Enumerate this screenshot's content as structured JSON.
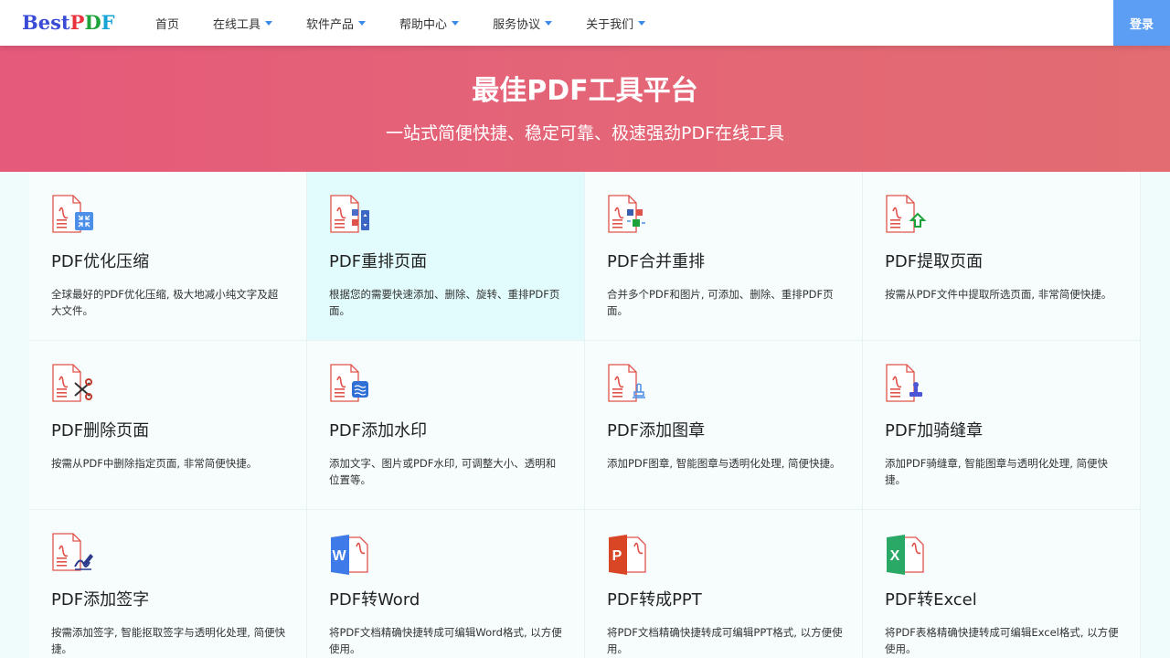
{
  "logo": {
    "best": "Best",
    "p": "P",
    "d": "D",
    "f": "F"
  },
  "nav": [
    {
      "label": "首页",
      "dropdown": false
    },
    {
      "label": "在线工具",
      "dropdown": true
    },
    {
      "label": "软件产品",
      "dropdown": true
    },
    {
      "label": "帮助中心",
      "dropdown": true
    },
    {
      "label": "服务协议",
      "dropdown": true
    },
    {
      "label": "关于我们",
      "dropdown": true
    }
  ],
  "login_label": "登录",
  "hero": {
    "title": "最佳PDF工具平台",
    "subtitle": "一站式简便快捷、稳定可靠、极速强劲PDF在线工具"
  },
  "tools": [
    {
      "name": "PDF优化压缩",
      "desc": "全球最好的PDF优化压缩, 极大地减小纯文字及超大文件。",
      "icon": "compress-icon"
    },
    {
      "name": "PDF重排页面",
      "desc": "根据您的需要快速添加、删除、旋转、重排PDF页面。",
      "icon": "reorder-icon"
    },
    {
      "name": "PDF合并重排",
      "desc": "合并多个PDF和图片, 可添加、删除、重排PDF页面。",
      "icon": "merge-icon"
    },
    {
      "name": "PDF提取页面",
      "desc": "按需从PDF文件中提取所选页面, 非常简便快捷。",
      "icon": "extract-icon"
    },
    {
      "name": "PDF删除页面",
      "desc": "按需从PDF中删除指定页面, 非常简便快捷。",
      "icon": "scissors-icon"
    },
    {
      "name": "PDF添加水印",
      "desc": "添加文字、图片或PDF水印, 可调整大小、透明和位置等。",
      "icon": "watermark-icon"
    },
    {
      "name": "PDF添加图章",
      "desc": "添加PDF图章, 智能图章与透明化处理, 简便快捷。",
      "icon": "stamp-icon"
    },
    {
      "name": "PDF加骑缝章",
      "desc": "添加PDF骑缝章, 智能图章与透明化处理, 简便快捷。",
      "icon": "seal-icon"
    },
    {
      "name": "PDF添加签字",
      "desc": "按需添加签字, 智能抠取签字与透明化处理, 简便快捷。",
      "icon": "signature-icon"
    },
    {
      "name": "PDF转Word",
      "desc": "将PDF文档精确快捷转成可编辑Word格式, 以方便使用。",
      "icon": "word-icon"
    },
    {
      "name": "PDF转成PPT",
      "desc": "将PDF文档精确快捷转成可编辑PPT格式, 以方便使用。",
      "icon": "ppt-icon"
    },
    {
      "name": "PDF转Excel",
      "desc": "将PDF表格精确快捷转成可编辑Excel格式, 以方便使用。",
      "icon": "excel-icon"
    }
  ],
  "colors": {
    "hero_start": "#e5597a",
    "hero_end": "#e26c72",
    "login_bg": "#5b9ef4",
    "pdf_red": "#e0534b",
    "card_bg": "#f7fdfd",
    "card_hover_bg": "#e2fcfd",
    "word_blue": "#3f7be8",
    "ppt_red": "#d84626",
    "excel_green": "#2aa865"
  }
}
